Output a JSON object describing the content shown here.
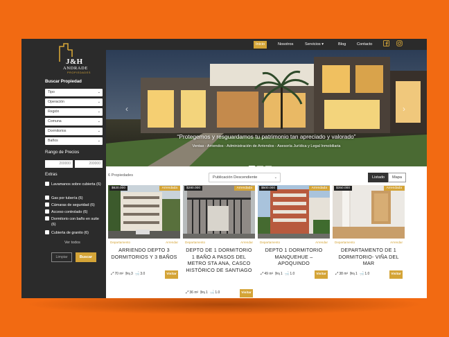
{
  "logo": {
    "name": "J&H",
    "subname": "ANDRADE",
    "tagline": "PROPIEDADES"
  },
  "nav": {
    "items": [
      "Inicio",
      "Nosotros",
      "Servicios",
      "Blog",
      "Contacto"
    ],
    "servicios_caret": "▾",
    "social": [
      "facebook-icon",
      "instagram-icon"
    ],
    "accent": "#d4a437"
  },
  "sidebar": {
    "search_title": "Buscar Propiedad",
    "filters": [
      "Tipo",
      "Operación",
      "Región",
      "Comuna",
      "Dormitorios",
      "Baños"
    ],
    "price_title": "Rango de Precios",
    "price_from": "200000",
    "price_to": "200000",
    "extras_title": "Extras",
    "extras": [
      "Lavamanos sobre cubierta (6)",
      "Gas por tubería (6)",
      "Cámaras de seguridad (6)",
      "Acceso controlado (6)",
      "Dormitorio con baño en suite (6)",
      "Cubierta de granito (6)"
    ],
    "ver_todos": "Ver todos",
    "limpiar": "Limpiar",
    "buscar": "Buscar"
  },
  "hero": {
    "quote": "“Protegemos y resguardamos tu patrimonio tan apreciado y valorado”",
    "subtitle": "Ventas - Arriendos - Administración de Arriendos - Asesoría Jurídica y Legal Inmobiliaria",
    "prev": "‹",
    "next": "›"
  },
  "listing": {
    "count": "6 Propiedades",
    "sort": "Publicación Descendiente",
    "view_list": "Listado",
    "view_map": "Mapa",
    "cards": [
      {
        "price": "$620.000",
        "status": "Arrendada",
        "type": "Departamento",
        "state": "Arrendar",
        "title": "ARRIENDO DEPTO 3 DORMITORIOS Y 3 BAÑOS",
        "area": "70 m²",
        "beds": "3",
        "baths": "3.0",
        "cta": "Visitar"
      },
      {
        "price": "$280.000",
        "status": "Arrendada",
        "type": "Departamento",
        "state": "Arrendar",
        "title": "DEPTO DE 1 DORMITORIO 1 BAÑO A PASOS DEL METRO STA ANA, CASCO HISTÓRICO DE SANTIAGO",
        "area": "36 m²",
        "beds": "1",
        "baths": "1.0",
        "cta": "Visitar"
      },
      {
        "price": "$500.000",
        "status": "Arrendada",
        "type": "Departamento",
        "state": "Arrendar",
        "title": "DEPTO 1 DORMITORIO MANQUEHUE – APOQUINDO",
        "area": "49 m²",
        "beds": "1",
        "baths": "1.0",
        "cta": "Visitar"
      },
      {
        "price": "$350.000",
        "status": "Arrendada",
        "type": "Departamento",
        "state": "Arrendar",
        "title": "DEPARTAMENTO DE 1 DORMITORIO- VIÑA DEL MAR",
        "area": "38 m²",
        "beds": "1",
        "baths": "1.0",
        "cta": "Visitar"
      }
    ]
  }
}
